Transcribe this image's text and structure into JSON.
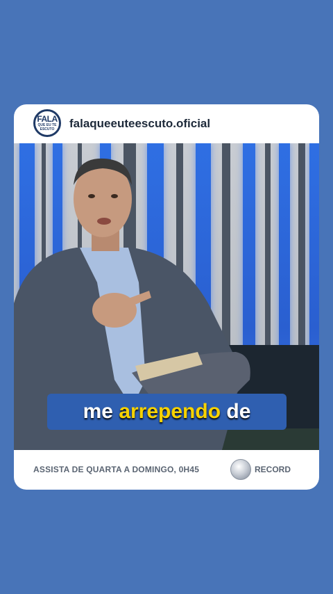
{
  "post": {
    "handle": "falaqueeuteescuto.oficial",
    "logo": {
      "line1": "FALA",
      "line2": "QUE EU TE",
      "line3": "ESCUTO"
    }
  },
  "video": {
    "caption_before": "me ",
    "caption_highlight": "arrependo",
    "caption_after": " de"
  },
  "footer": {
    "text": "ASSISTA DE QUARTA A DOMINGO, 0H45",
    "brand": "RECORD"
  },
  "colors": {
    "background": "#4874b8",
    "caption_box": "#2f5fb0",
    "caption_highlight": "#f7d200"
  }
}
